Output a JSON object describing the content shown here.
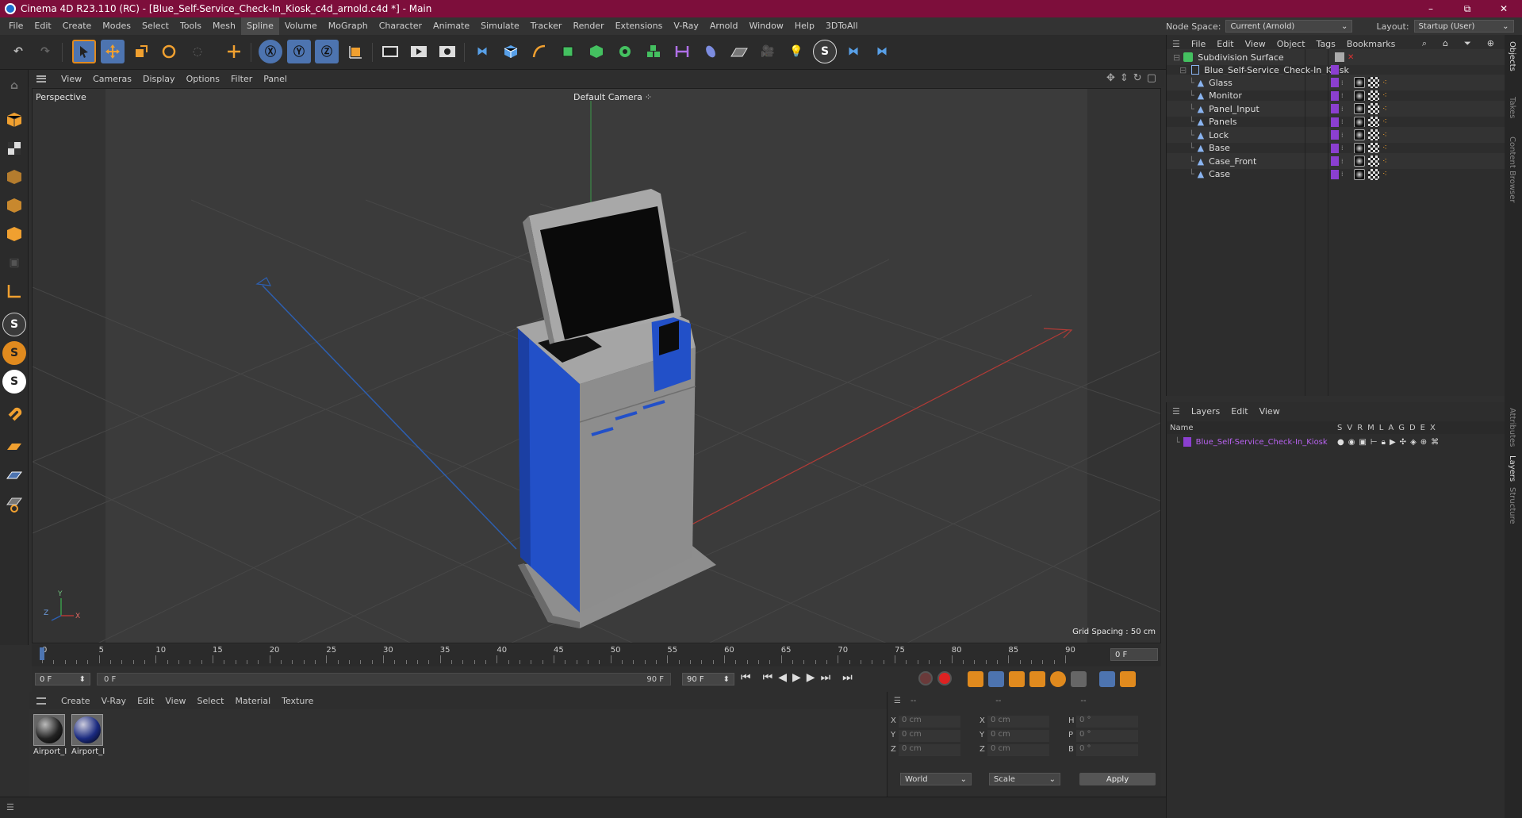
{
  "window": {
    "title": "Cinema 4D R23.110 (RC) - [Blue_Self-Service_Check-In_Kiosk_c4d_arnold.c4d *] - Main",
    "minimize": "–",
    "maximize": "⧉",
    "close": "✕"
  },
  "menubar": {
    "items": [
      "File",
      "Edit",
      "Create",
      "Modes",
      "Select",
      "Tools",
      "Mesh",
      "Spline",
      "Volume",
      "MoGraph",
      "Character",
      "Animate",
      "Simulate",
      "Tracker",
      "Render",
      "Extensions",
      "V-Ray",
      "Arnold",
      "Window",
      "Help",
      "3DToAll"
    ],
    "active": "Spline"
  },
  "nodespace": {
    "label": "Node Space:",
    "value": "Current (Arnold)"
  },
  "layout": {
    "label": "Layout:",
    "value": "Startup (User)"
  },
  "viewport": {
    "menu": [
      "View",
      "Cameras",
      "Display",
      "Options",
      "Filter",
      "Panel"
    ],
    "view_name": "Perspective",
    "camera": "Default Camera",
    "camera_icon": "⁘",
    "grid_spacing": "Grid Spacing : 50 cm",
    "axis_y": "Y",
    "axis_x": "X",
    "axis_z": "Z"
  },
  "timeline": {
    "ticks": [
      "0",
      "5",
      "10",
      "15",
      "20",
      "25",
      "30",
      "35",
      "40",
      "45",
      "50",
      "55",
      "60",
      "65",
      "70",
      "75",
      "80",
      "85",
      "90"
    ],
    "current_frame_right": "0 F"
  },
  "transport": {
    "start_field": "0 F",
    "range_start": "0 F",
    "range_end": "90 F",
    "end_field": "90 F"
  },
  "material_manager": {
    "menu": [
      "Create",
      "V-Ray",
      "Edit",
      "View",
      "Select",
      "Material",
      "Texture"
    ],
    "materials": [
      {
        "label": "Airport_I"
      },
      {
        "label": "Airport_I"
      }
    ]
  },
  "coordinates": {
    "headers": [
      "--",
      "--",
      "--"
    ],
    "rows": [
      {
        "a_label": "X",
        "a_val": "0 cm",
        "b_label": "X",
        "b_val": "0 cm",
        "c_label": "H",
        "c_val": "0 °"
      },
      {
        "a_label": "Y",
        "a_val": "0 cm",
        "b_label": "Y",
        "b_val": "0 cm",
        "c_label": "P",
        "c_val": "0 °"
      },
      {
        "a_label": "Z",
        "a_val": "0 cm",
        "b_label": "Z",
        "b_val": "0 cm",
        "c_label": "B",
        "c_val": "0 °"
      }
    ],
    "world": "World",
    "scale": "Scale",
    "apply": "Apply"
  },
  "object_manager": {
    "menu": [
      "File",
      "Edit",
      "View",
      "Object",
      "Tags",
      "Bookmarks"
    ],
    "root": "Subdivision Surface",
    "group": "Blue_Self-Service_Check-In_Kiosk",
    "children": [
      "Glass",
      "Monitor",
      "Panel_Input",
      "Panels",
      "Lock",
      "Base",
      "Case_Front",
      "Case"
    ]
  },
  "layer_manager": {
    "menu": [
      "Layers",
      "Edit",
      "View"
    ],
    "col_name": "Name",
    "cols": [
      "S",
      "V",
      "R",
      "M",
      "L",
      "A",
      "G",
      "D",
      "E",
      "X"
    ],
    "layer": "Blue_Self-Service_Check-In_Kiosk"
  },
  "side_tabs": [
    "Objects",
    "Takes",
    "Content Browser",
    "Attributes",
    "Layers",
    "Structure"
  ],
  "colors": {
    "accent": "#7d0e3b",
    "layer_purple": "#8b3fd0",
    "kiosk_blue": "#2250c8"
  }
}
